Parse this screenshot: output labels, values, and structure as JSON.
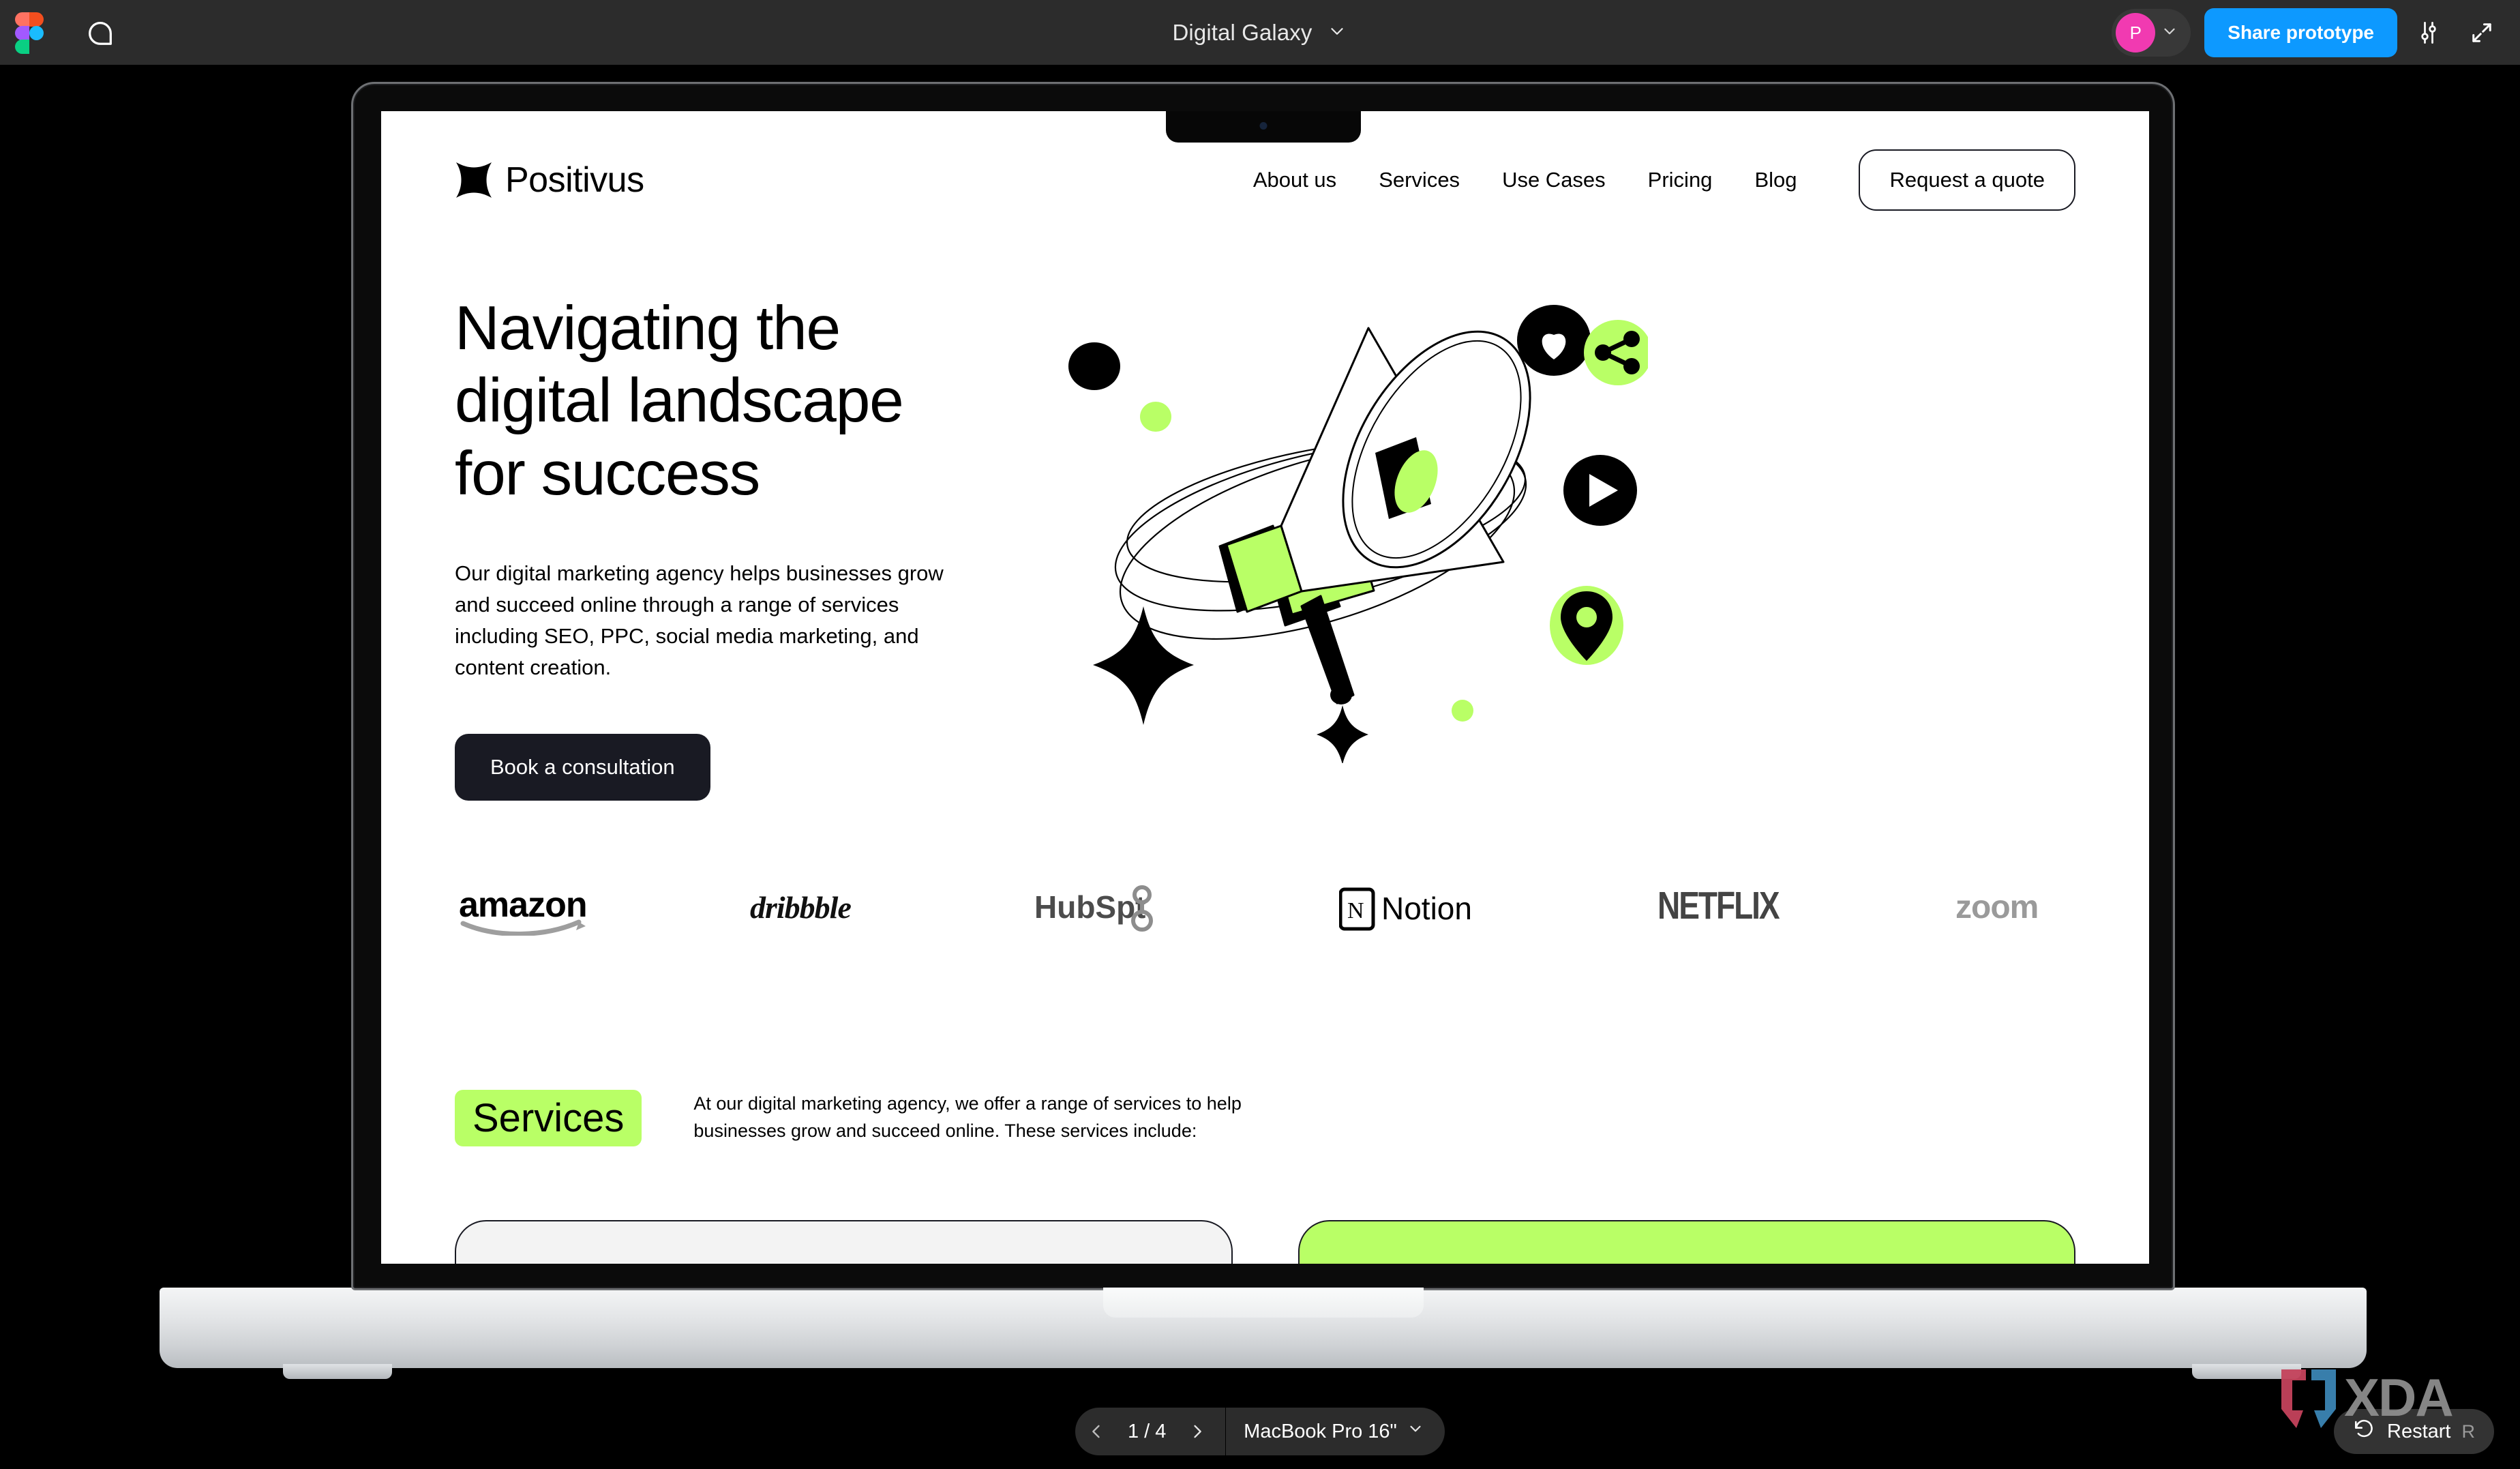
{
  "app": {
    "name": "Figma",
    "topbar": {
      "logo_icon": "figma-logo-icon",
      "comment_icon": "comment-bubble-icon",
      "document_title": "Digital Galaxy",
      "title_chevron_icon": "chevron-down-icon",
      "avatar_initial": "P",
      "avatar_chevron_icon": "chevron-down-icon",
      "share_label": "Share prototype",
      "options_icon": "sliders-icon",
      "fullscreen_icon": "expand-arrows-icon",
      "accent_blue": "#0d99ff",
      "avatar_color": "#f13ab1",
      "bar_background": "#2c2c2c"
    },
    "annotation": {
      "arrow_icon": "red-arrow-up-icon",
      "color": "#f6343f"
    },
    "bottombar": {
      "prev_icon": "chevron-left-icon",
      "next_icon": "chevron-right-icon",
      "page_indicator": "1 / 4",
      "device_label": "MacBook Pro 16\"",
      "device_chevron_icon": "chevron-down-icon",
      "restart_icon": "undo-arrow-icon",
      "restart_label": "Restart",
      "restart_shortcut": "R"
    },
    "watermark": {
      "text": "XDA",
      "mark_icon": "xda-bracket-icon"
    }
  },
  "device": {
    "model": "MacBook Pro 16\"",
    "notch_icon": "macbook-notch-camera"
  },
  "site": {
    "brand": {
      "logo_icon": "positivus-star-icon",
      "name": "Positivus"
    },
    "nav": [
      {
        "label": "About us"
      },
      {
        "label": "Services"
      },
      {
        "label": "Use Cases"
      },
      {
        "label": "Pricing"
      },
      {
        "label": "Blog"
      }
    ],
    "cta_button": "Request a quote",
    "hero": {
      "title_line1": "Navigating the",
      "title_line2": "digital landscape",
      "title_line3": "for success",
      "description": "Our digital marketing agency helps businesses grow and succeed online through a range of services including SEO, PPC, social media marketing, and content creation.",
      "button": "Book a consultation",
      "illustration": {
        "name": "megaphone-orbit-illustration",
        "badges": [
          {
            "icon": "heart-icon",
            "bg": "#000000",
            "fg": "#ffffff"
          },
          {
            "icon": "share-icon",
            "bg": "#b9ff66",
            "fg": "#000000"
          },
          {
            "icon": "play-icon",
            "bg": "#000000",
            "fg": "#ffffff"
          },
          {
            "icon": "location-pin-icon",
            "bg": "#b9ff66",
            "fg": "#000000"
          }
        ],
        "accent_green": "#b9ff66"
      }
    },
    "logos": [
      {
        "name": "amazon"
      },
      {
        "name": "dribbble"
      },
      {
        "name": "HubSpot"
      },
      {
        "name": "Notion"
      },
      {
        "name": "NETFLIX"
      },
      {
        "name": "zoom"
      }
    ],
    "services": {
      "pill_label": "Services",
      "description": "At our digital marketing agency, we offer a range of services to help businesses grow and succeed online. These services include:",
      "cards": [
        {
          "variant": "light"
        },
        {
          "variant": "green"
        }
      ]
    },
    "colors": {
      "green": "#b9ff66",
      "dark": "#191a23",
      "light": "#f3f3f3"
    }
  }
}
